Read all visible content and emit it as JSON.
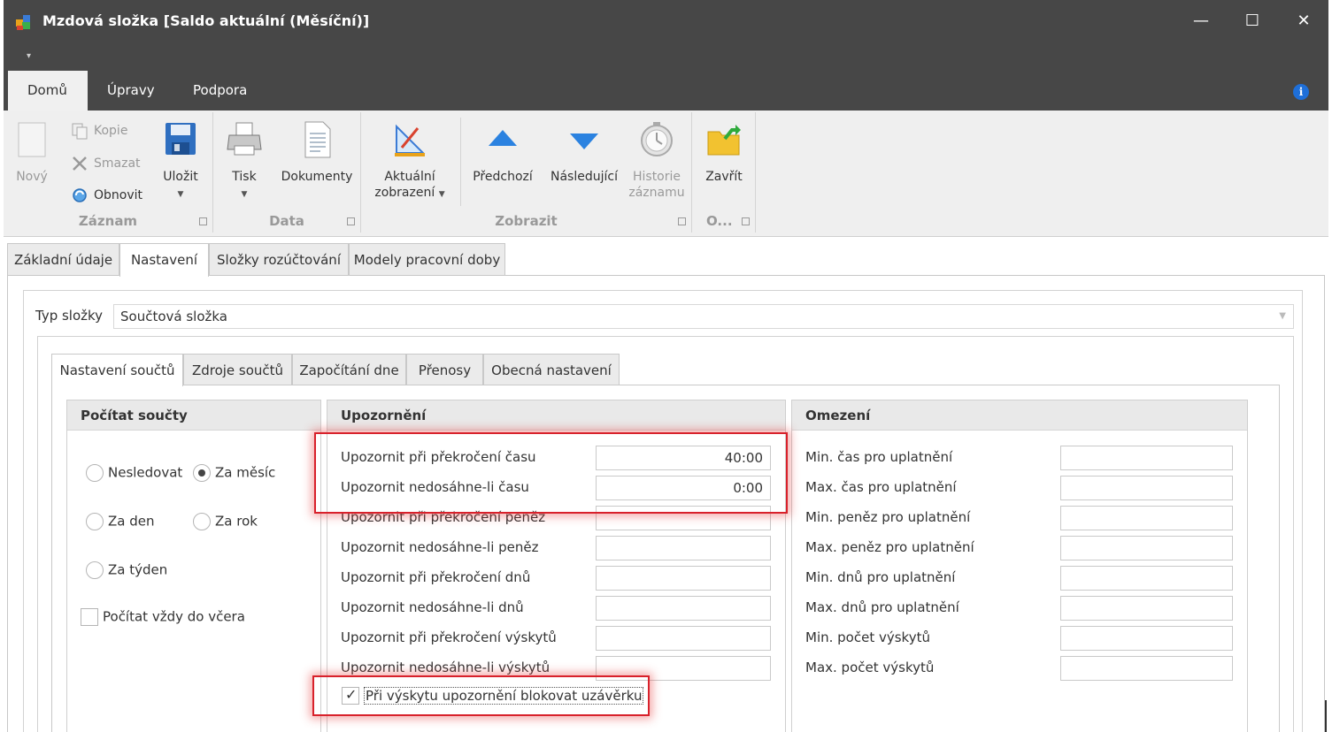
{
  "window": {
    "title": "Mzdová složka [Saldo aktuální (Měsíční)]",
    "min": "—",
    "max": "☐",
    "close": "✕",
    "qat": "▾"
  },
  "ribbon_tabs": [
    "Domů",
    "Úpravy",
    "Podpora"
  ],
  "ribbon": {
    "zaznam": {
      "label": "Záznam",
      "novy": "Nový",
      "kopie": "Kopie",
      "smazat": "Smazat",
      "obnovit": "Obnovit",
      "ulozit": "Uložit"
    },
    "data": {
      "label": "Data",
      "tisk": "Tisk",
      "dokumenty": "Dokumenty"
    },
    "zobrazit": {
      "label": "Zobrazit",
      "aktualni1": "Aktuální",
      "aktualni2": "zobrazení",
      "predchozi": "Předchozí",
      "nasledujici": "Následující",
      "historie1": "Historie",
      "historie2": "záznamu"
    },
    "other": {
      "label": "O...",
      "zavrit": "Zavřít"
    }
  },
  "main_tabs": [
    "Základní údaje",
    "Nastavení",
    "Složky rozúčtování",
    "Modely pracovní doby"
  ],
  "typ": {
    "label": "Typ složky",
    "value": "Součtová složka"
  },
  "sub_tabs": [
    "Nastavení součtů",
    "Zdroje součtů",
    "Započítání dne",
    "Přenosy",
    "Obecná nastavení"
  ],
  "pocitat": {
    "title": "Počítat součty",
    "nesledovat": "Nesledovat",
    "za_mesic": "Za měsíc",
    "za_den": "Za den",
    "za_rok": "Za rok",
    "za_tyden": "Za týden",
    "vzdy_do_vcera": "Počítat vždy do včera"
  },
  "upozorneni": {
    "title": "Upozornění",
    "rows": [
      {
        "label": "Upozornit při překročení času",
        "value": "40:00"
      },
      {
        "label": "Upozornit nedosáhne-li času",
        "value": "0:00"
      },
      {
        "label": "Upozornit při překročení peněz",
        "value": ""
      },
      {
        "label": "Upozornit nedosáhne-li peněz",
        "value": ""
      },
      {
        "label": "Upozornit při překročení dnů",
        "value": ""
      },
      {
        "label": "Upozornit nedosáhne-li dnů",
        "value": ""
      },
      {
        "label": "Upozornit při překročení výskytů",
        "value": ""
      },
      {
        "label": "Upozornit nedosáhne-li výskytů",
        "value": ""
      }
    ],
    "blokovat": "Při výskytu upozornění blokovat uzávěrku"
  },
  "omezeni": {
    "title": "Omezení",
    "rows": [
      {
        "label": "Min. čas pro uplatnění",
        "value": ""
      },
      {
        "label": "Max. čas pro uplatnění",
        "value": ""
      },
      {
        "label": "Min. peněz pro uplatnění",
        "value": ""
      },
      {
        "label": "Max. peněz pro uplatnění",
        "value": ""
      },
      {
        "label": "Min. dnů pro uplatnění",
        "value": ""
      },
      {
        "label": "Max. dnů pro uplatnění",
        "value": ""
      },
      {
        "label": "Min. počet výskytů",
        "value": ""
      },
      {
        "label": "Max. počet výskytů",
        "value": ""
      }
    ]
  },
  "colors": {
    "titlebar": "#474747",
    "highlight": "#d8212b",
    "accent": "#1e6fd9"
  }
}
